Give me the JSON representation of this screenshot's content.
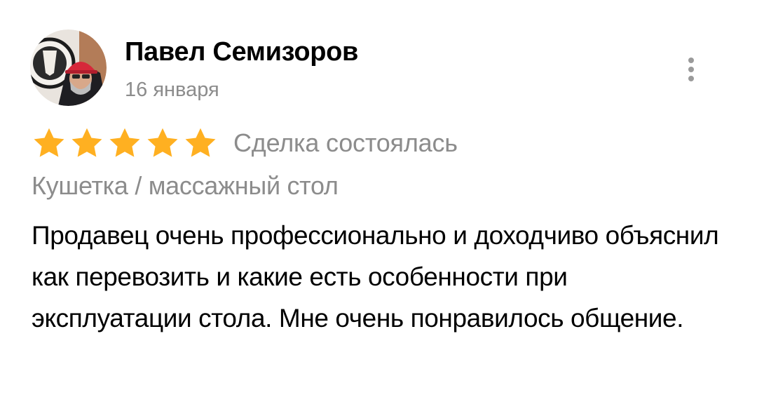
{
  "review": {
    "author_name": "Павел Семизоров",
    "date": "16 января",
    "rating": 5,
    "rating_max": 5,
    "deal_status": "Сделка состоялась",
    "item_title": "Кушетка / массажный стол",
    "text": "Продавец очень профессионально и доходчиво объяснил как перевозить и какие есть особенности при эксплуатации стола. Мне очень понравилось общение."
  },
  "icons": {
    "star": "star-icon",
    "menu": "more-vertical-icon",
    "avatar": "user-avatar"
  },
  "colors": {
    "star": "#FFB021",
    "secondary_text": "#8C8C8C",
    "primary_text": "#000000",
    "menu_dots": "#9A9A9A"
  }
}
